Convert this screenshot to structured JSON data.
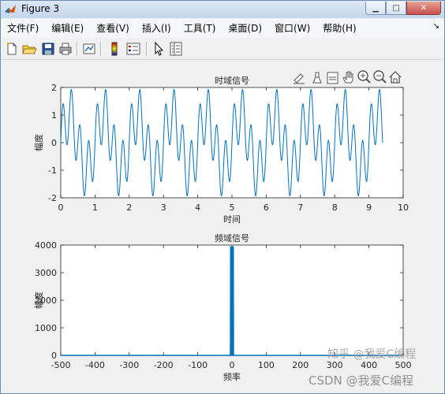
{
  "window": {
    "title": "Figure 3"
  },
  "menu": [
    "文件(F)",
    "编辑(E)",
    "查看(V)",
    "插入(I)",
    "工具(T)",
    "桌面(D)",
    "窗口(W)",
    "帮助(H)"
  ],
  "watermark": {
    "line1": "知乎 @我爱C编程",
    "line2": "CSDN @我爱C编程"
  },
  "chart_data": [
    {
      "type": "line",
      "title": "时域信号",
      "xlabel": "时间",
      "ylabel": "幅度",
      "xlim": [
        0,
        10
      ],
      "ylim": [
        -2,
        2
      ],
      "xticks": [
        "0",
        "1",
        "2",
        "3",
        "4",
        "5",
        "6",
        "7",
        "8",
        "9",
        "10"
      ],
      "yticks": [
        "-2",
        "-1",
        "0",
        "1",
        "2"
      ],
      "x_range": [
        0,
        9.4
      ],
      "signal": "sin(2π·1·t)+sin(2π·4·t), sampled"
    },
    {
      "type": "line",
      "title": "频域信号",
      "xlabel": "频率",
      "ylabel": "幅度",
      "xlim": [
        -500,
        500
      ],
      "ylim": [
        0,
        4000
      ],
      "xticks": [
        "-500",
        "-400",
        "-300",
        "-200",
        "-100",
        "0",
        "100",
        "200",
        "300",
        "400",
        "500"
      ],
      "yticks": [
        "0",
        "1000",
        "2000",
        "3000",
        "4000"
      ],
      "peaks": [
        {
          "x": -4,
          "y": 3950
        },
        {
          "x": -1,
          "y": 3950
        },
        {
          "x": 1,
          "y": 3950
        },
        {
          "x": 4,
          "y": 3950
        }
      ]
    }
  ]
}
